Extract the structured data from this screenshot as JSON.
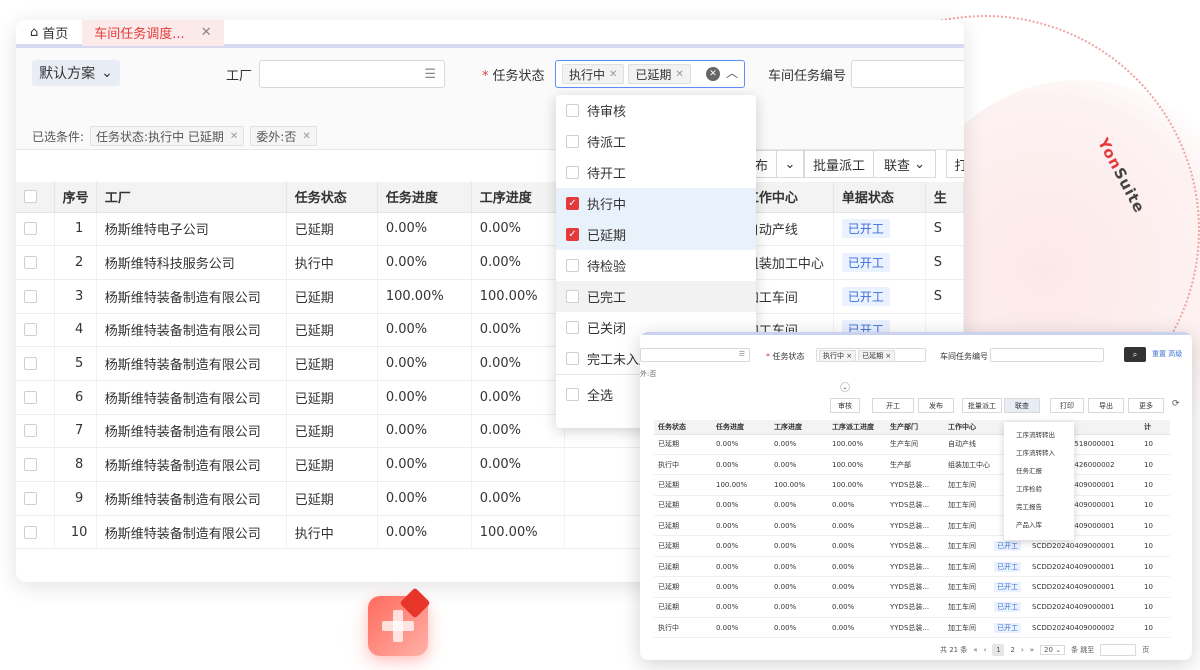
{
  "brand": {
    "a": "Yon",
    "b": "Suite"
  },
  "tabs": {
    "home": "首页",
    "active": "车间任务调度..."
  },
  "filters": {
    "scheme": "默认方案",
    "factory_label": "工厂",
    "status_label": "任务状态",
    "status_chips": [
      "执行中",
      "已延期"
    ],
    "code_label": "车间任务编号",
    "selected_label": "已选条件:",
    "selected_chips": [
      "任务状态:执行中 已延期",
      "委外:否"
    ]
  },
  "toolbar": {
    "publish": "布",
    "batch_dispatch": "批量派工",
    "linked": "联查",
    "print": "打"
  },
  "table": {
    "headers": [
      "序号",
      "工厂",
      "任务状态",
      "任务进度",
      "工序进度",
      "工作中心",
      "单据状态",
      "生"
    ],
    "rows": [
      {
        "no": "1",
        "factory": "杨斯维特电子公司",
        "status": "已延期",
        "progress": "0.00%",
        "proc": "0.00%",
        "center": "自动产线",
        "doc": "已开工",
        "extra": "S"
      },
      {
        "no": "2",
        "factory": "杨斯维特科技服务公司",
        "status": "执行中",
        "progress": "0.00%",
        "proc": "0.00%",
        "center": "组装加工中心",
        "doc": "已开工",
        "extra": "S"
      },
      {
        "no": "3",
        "factory": "杨斯维特装备制造有限公司",
        "status": "已延期",
        "progress": "100.00%",
        "proc": "100.00%",
        "center": "加工车间",
        "doc": "已开工",
        "extra": "S"
      },
      {
        "no": "4",
        "factory": "杨斯维特装备制造有限公司",
        "status": "已延期",
        "progress": "0.00%",
        "proc": "0.00%",
        "center": "加工车间",
        "doc": "已开工",
        "extra": ""
      },
      {
        "no": "5",
        "factory": "杨斯维特装备制造有限公司",
        "status": "已延期",
        "progress": "0.00%",
        "proc": "0.00%",
        "center": "",
        "doc": "",
        "extra": ""
      },
      {
        "no": "6",
        "factory": "杨斯维特装备制造有限公司",
        "status": "已延期",
        "progress": "0.00%",
        "proc": "0.00%",
        "center": "",
        "doc": "",
        "extra": ""
      },
      {
        "no": "7",
        "factory": "杨斯维特装备制造有限公司",
        "status": "已延期",
        "progress": "0.00%",
        "proc": "0.00%",
        "center": "",
        "doc": "",
        "extra": ""
      },
      {
        "no": "8",
        "factory": "杨斯维特装备制造有限公司",
        "status": "已延期",
        "progress": "0.00%",
        "proc": "0.00%",
        "center": "",
        "doc": "",
        "extra": ""
      },
      {
        "no": "9",
        "factory": "杨斯维特装备制造有限公司",
        "status": "已延期",
        "progress": "0.00%",
        "proc": "0.00%",
        "center": "",
        "doc": "",
        "extra": ""
      },
      {
        "no": "10",
        "factory": "杨斯维特装备制造有限公司",
        "status": "执行中",
        "progress": "0.00%",
        "proc": "100.00%",
        "center": "",
        "doc": "",
        "extra": ""
      }
    ]
  },
  "dropdown": {
    "options": [
      {
        "label": "待审核",
        "checked": false
      },
      {
        "label": "待派工",
        "checked": false
      },
      {
        "label": "待开工",
        "checked": false
      },
      {
        "label": "执行中",
        "checked": true
      },
      {
        "label": "已延期",
        "checked": true
      },
      {
        "label": "待检验",
        "checked": false
      },
      {
        "label": "已完工",
        "checked": false
      },
      {
        "label": "已关闭",
        "checked": false
      },
      {
        "label": "完工未入库",
        "checked": false
      }
    ],
    "select_all": "全选"
  },
  "mini": {
    "status_label": "任务状态",
    "chips": [
      "执行中",
      "已延期"
    ],
    "code_label": "车间任务编号",
    "reset": "重置 高级",
    "cond": "外:否",
    "toolbar": [
      "审核",
      "开工",
      "发布",
      "批量派工",
      "联查",
      "打印",
      "导出",
      "更多"
    ],
    "headers": [
      "任务状态",
      "任务进度",
      "工序进度",
      "工序派工进度",
      "生产部门",
      "工作中心",
      "",
      "订单号",
      "计"
    ],
    "rows": [
      [
        "已延期",
        "0.00%",
        "0.00%",
        "100.00%",
        "生产车间",
        "自动产线",
        "",
        "SCDD20240518000001",
        "10"
      ],
      [
        "执行中",
        "0.00%",
        "0.00%",
        "100.00%",
        "生产部",
        "组装加工中心",
        "",
        "SCDD20240426000002",
        "10"
      ],
      [
        "已延期",
        "100.00%",
        "100.00%",
        "100.00%",
        "YYDS总装...",
        "加工车间",
        "",
        "SCDD20240409000001",
        "10"
      ],
      [
        "已延期",
        "0.00%",
        "0.00%",
        "0.00%",
        "YYDS总装...",
        "加工车间",
        "",
        "SCDD20240409000001",
        "10"
      ],
      [
        "已延期",
        "0.00%",
        "0.00%",
        "0.00%",
        "YYDS总装...",
        "加工车间",
        "",
        "SCDD20240409000001",
        "10"
      ],
      [
        "已延期",
        "0.00%",
        "0.00%",
        "0.00%",
        "YYDS总装...",
        "加工车间",
        "已开工",
        "SCDD20240409000001",
        "10"
      ],
      [
        "已延期",
        "0.00%",
        "0.00%",
        "0.00%",
        "YYDS总装...",
        "加工车间",
        "已开工",
        "SCDD20240409000001",
        "10"
      ],
      [
        "已延期",
        "0.00%",
        "0.00%",
        "0.00%",
        "YYDS总装...",
        "加工车间",
        "已开工",
        "SCDD20240409000001",
        "10"
      ],
      [
        "已延期",
        "0.00%",
        "0.00%",
        "0.00%",
        "YYDS总装...",
        "加工车间",
        "已开工",
        "SCDD20240409000001",
        "10"
      ],
      [
        "执行中",
        "0.00%",
        "0.00%",
        "0.00%",
        "YYDS总装...",
        "加工车间",
        "已开工",
        "SCDD20240409000002",
        "10"
      ]
    ],
    "menu": [
      "工序流转转出",
      "工序流转转入",
      "任务汇报",
      "工序检验",
      "完工报告",
      "产品入库"
    ],
    "pager": {
      "total": "共 21 条",
      "p1": "1",
      "p2": "2",
      "size": "20",
      "per": "条 跳至",
      "page": "页"
    }
  }
}
